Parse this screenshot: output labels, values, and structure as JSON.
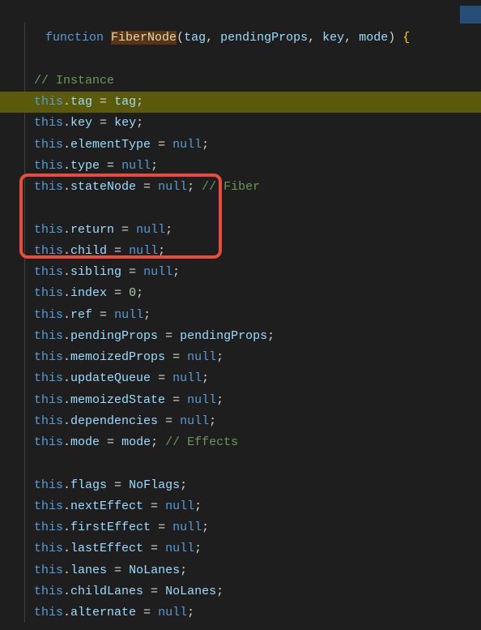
{
  "code": {
    "fn_keyword": "function",
    "fn_name": "FiberNode",
    "params": [
      "tag",
      "pendingProps",
      "key",
      "mode"
    ],
    "open_brace": "{",
    "comment_instance": "// Instance",
    "comment_fiber": "// Fiber",
    "comment_effects": "// Effects",
    "lines": {
      "tag": {
        "this": "this",
        "prop": "tag",
        "op": " = ",
        "val": "tag",
        "end": ";"
      },
      "key": {
        "this": "this",
        "prop": "key",
        "op": " = ",
        "val": "key",
        "end": ";"
      },
      "elementType": {
        "this": "this",
        "prop": "elementType",
        "op": " = ",
        "val": "null",
        "end": ";"
      },
      "type": {
        "this": "this",
        "prop": "type",
        "op": " = ",
        "val": "null",
        "end": ";"
      },
      "stateNode": {
        "this": "this",
        "prop": "stateNode",
        "op": " = ",
        "val": "null",
        "end": ";"
      },
      "return": {
        "this": "this",
        "prop": "return",
        "op": " = ",
        "val": "null",
        "end": ";"
      },
      "child": {
        "this": "this",
        "prop": "child",
        "op": " = ",
        "val": "null",
        "end": ";"
      },
      "sibling": {
        "this": "this",
        "prop": "sibling",
        "op": " = ",
        "val": "null",
        "end": ";"
      },
      "index": {
        "this": "this",
        "prop": "index",
        "op": " = ",
        "val": "0",
        "end": ";"
      },
      "ref": {
        "this": "this",
        "prop": "ref",
        "op": " = ",
        "val": "null",
        "end": ";"
      },
      "pendingProps": {
        "this": "this",
        "prop": "pendingProps",
        "op": " = ",
        "val": "pendingProps",
        "end": ";"
      },
      "memoizedProps": {
        "this": "this",
        "prop": "memoizedProps",
        "op": " = ",
        "val": "null",
        "end": ";"
      },
      "updateQueue": {
        "this": "this",
        "prop": "updateQueue",
        "op": " = ",
        "val": "null",
        "end": ";"
      },
      "memoizedState": {
        "this": "this",
        "prop": "memoizedState",
        "op": " = ",
        "val": "null",
        "end": ";"
      },
      "dependencies": {
        "this": "this",
        "prop": "dependencies",
        "op": " = ",
        "val": "null",
        "end": ";"
      },
      "mode": {
        "this": "this",
        "prop": "mode",
        "op": " = ",
        "val": "mode",
        "end": ";"
      },
      "flags": {
        "this": "this",
        "prop": "flags",
        "op": " = ",
        "val": "NoFlags",
        "end": ";"
      },
      "nextEffect": {
        "this": "this",
        "prop": "nextEffect",
        "op": " = ",
        "val": "null",
        "end": ";"
      },
      "firstEffect": {
        "this": "this",
        "prop": "firstEffect",
        "op": " = ",
        "val": "null",
        "end": ";"
      },
      "lastEffect": {
        "this": "this",
        "prop": "lastEffect",
        "op": " = ",
        "val": "null",
        "end": ";"
      },
      "lanes": {
        "this": "this",
        "prop": "lanes",
        "op": " = ",
        "val": "NoLanes",
        "end": ";"
      },
      "childLanes": {
        "this": "this",
        "prop": "childLanes",
        "op": " = ",
        "val": "NoLanes",
        "end": ";"
      },
      "alternate": {
        "this": "this",
        "prop": "alternate",
        "op": " = ",
        "val": "null",
        "end": ";"
      }
    },
    "dot": ".",
    "comma": ", "
  }
}
